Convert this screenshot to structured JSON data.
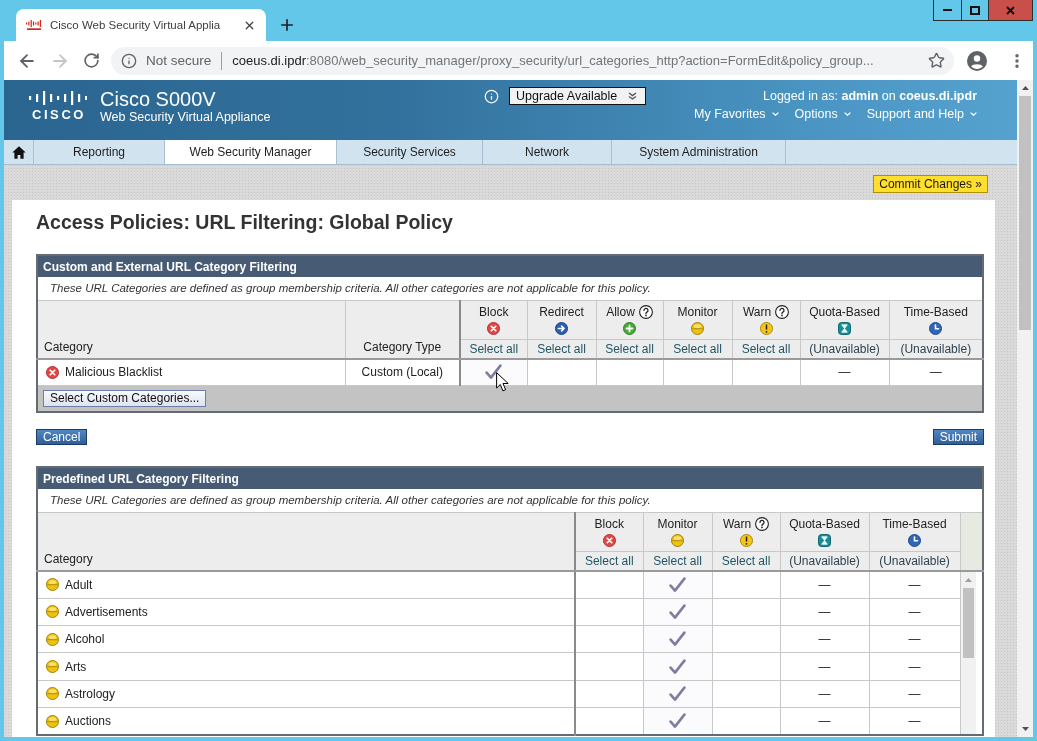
{
  "browser": {
    "tab": {
      "title": "Cisco Web Security Virtual Applia"
    },
    "toolbar": [
      {
        "kind": "back",
        "disabled": false
      },
      {
        "kind": "forward",
        "disabled": true
      },
      {
        "kind": "reload",
        "disabled": false
      }
    ],
    "address": {
      "security": "Not secure",
      "host": "coeus.di.ipdr",
      "path": ":8080/web_security_manager/proxy_security/url_categories_http?action=FormEdit&policy_group..."
    }
  },
  "header": {
    "logo_text": "CISCO",
    "product": "Cisco S000V",
    "subtitle": "Web Security Virtual Appliance",
    "upgrade": "Upgrade Available",
    "login": "Logged in as: **admin** on **coeus.di.ipdr**",
    "menus": [
      "My Favorites",
      "Options",
      "Support and Help"
    ]
  },
  "nav": {
    "tabs": [
      {
        "label": "Reporting",
        "selected": false
      },
      {
        "label": "Web Security Manager",
        "selected": true
      },
      {
        "label": "Security Services",
        "selected": false
      },
      {
        "label": "Network",
        "selected": false
      },
      {
        "label": "System Administration",
        "selected": false
      }
    ]
  },
  "commit_button": "Commit Changes »",
  "page_title": "Access Policies: URL Filtering: Global Policy",
  "custom_filtering": {
    "title": "Custom and External URL Category Filtering",
    "note": "These URL Categories are defined as group membership criteria. All other categories are not applicable for this policy.",
    "category_header": "Category",
    "type_header": "Category Type",
    "actions": [
      {
        "label": "Block",
        "kind": "block",
        "help": false,
        "select": "Select all"
      },
      {
        "label": "Redirect",
        "kind": "redirect",
        "help": false,
        "select": "Select all"
      },
      {
        "label": "Allow",
        "kind": "allow",
        "help": true,
        "select": "Select all"
      },
      {
        "label": "Monitor",
        "kind": "monitor",
        "help": false,
        "select": "Select all"
      },
      {
        "label": "Warn",
        "kind": "warn",
        "help": true,
        "select": "Select all"
      }
    ],
    "limits": [
      {
        "label": "Quota-Based",
        "kind": "quota",
        "status": "(Unavailable)"
      },
      {
        "label": "Time-Based",
        "kind": "time",
        "status": "(Unavailable)"
      }
    ],
    "rows": [
      {
        "name": "Malicious Blacklist",
        "kind": "block",
        "type": "Custom (Local)",
        "checks": [
          true,
          false,
          false,
          false,
          false
        ],
        "limits": [
          "—",
          "—"
        ]
      }
    ],
    "footer_button": "Select Custom Categories..."
  },
  "buttons": {
    "cancel": "Cancel",
    "submit": "Submit"
  },
  "predefined_filtering": {
    "title": "Predefined URL Category Filtering",
    "note": "These URL Categories are defined as group membership criteria. All other categories are not applicable for this policy.",
    "category_header": "Category",
    "actions": [
      {
        "label": "Block",
        "kind": "block",
        "help": false,
        "select": "Select all"
      },
      {
        "label": "Monitor",
        "kind": "monitor",
        "help": false,
        "select": "Select all"
      },
      {
        "label": "Warn",
        "kind": "warn",
        "help": true,
        "select": "Select all"
      }
    ],
    "limits": [
      {
        "label": "Quota-Based",
        "kind": "quota",
        "status": "(Unavailable)"
      },
      {
        "label": "Time-Based",
        "kind": "time",
        "status": "(Unavailable)"
      }
    ],
    "rows": [
      {
        "name": "Adult",
        "kind": "monitor",
        "checks": [
          false,
          true,
          false
        ],
        "limits": [
          "—",
          "—"
        ]
      },
      {
        "name": "Advertisements",
        "kind": "monitor",
        "checks": [
          false,
          true,
          false
        ],
        "limits": [
          "—",
          "—"
        ]
      },
      {
        "name": "Alcohol",
        "kind": "monitor",
        "checks": [
          false,
          true,
          false
        ],
        "limits": [
          "—",
          "—"
        ]
      },
      {
        "name": "Arts",
        "kind": "monitor",
        "checks": [
          false,
          true,
          false
        ],
        "limits": [
          "—",
          "—"
        ]
      },
      {
        "name": "Astrology",
        "kind": "monitor",
        "checks": [
          false,
          true,
          false
        ],
        "limits": [
          "—",
          "—"
        ]
      },
      {
        "name": "Auctions",
        "kind": "monitor",
        "checks": [
          false,
          true,
          false
        ],
        "limits": [
          "—",
          "—"
        ]
      }
    ]
  }
}
